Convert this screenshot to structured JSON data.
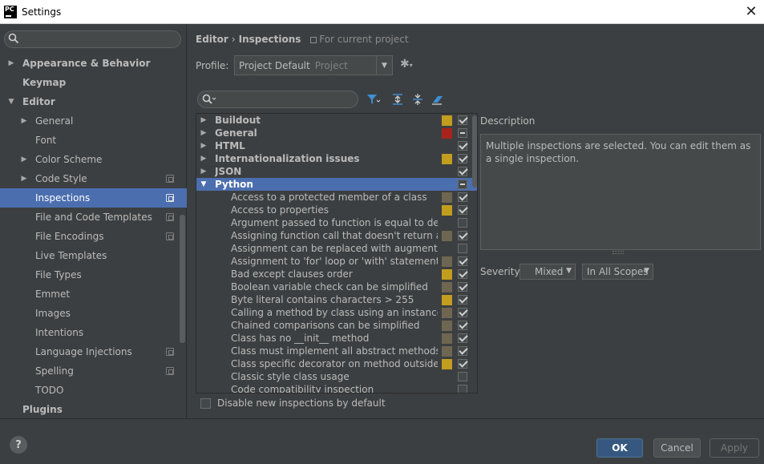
{
  "window": {
    "title": "Settings",
    "app_icon_text": "PC"
  },
  "sidebar": {
    "search_placeholder": "",
    "items": [
      {
        "label": "Appearance & Behavior",
        "bold": true,
        "arrow": "▶",
        "indent": 0
      },
      {
        "label": "Keymap",
        "bold": true,
        "arrow": "",
        "indent": 0
      },
      {
        "label": "Editor",
        "bold": true,
        "arrow": "▼",
        "indent": 0
      },
      {
        "label": "General",
        "bold": false,
        "arrow": "▶",
        "indent": 1
      },
      {
        "label": "Font",
        "bold": false,
        "arrow": "",
        "indent": 1
      },
      {
        "label": "Color Scheme",
        "bold": false,
        "arrow": "▶",
        "indent": 1
      },
      {
        "label": "Code Style",
        "bold": false,
        "arrow": "▶",
        "indent": 1,
        "project": true
      },
      {
        "label": "Inspections",
        "bold": false,
        "arrow": "",
        "indent": 1,
        "project": true,
        "selected": true
      },
      {
        "label": "File and Code Templates",
        "bold": false,
        "arrow": "",
        "indent": 1,
        "project": true
      },
      {
        "label": "File Encodings",
        "bold": false,
        "arrow": "",
        "indent": 1,
        "project": true
      },
      {
        "label": "Live Templates",
        "bold": false,
        "arrow": "",
        "indent": 1
      },
      {
        "label": "File Types",
        "bold": false,
        "arrow": "",
        "indent": 1
      },
      {
        "label": "Emmet",
        "bold": false,
        "arrow": "",
        "indent": 1
      },
      {
        "label": "Images",
        "bold": false,
        "arrow": "",
        "indent": 1
      },
      {
        "label": "Intentions",
        "bold": false,
        "arrow": "",
        "indent": 1
      },
      {
        "label": "Language Injections",
        "bold": false,
        "arrow": "",
        "indent": 1,
        "project": true
      },
      {
        "label": "Spelling",
        "bold": false,
        "arrow": "",
        "indent": 1,
        "project": true
      },
      {
        "label": "TODO",
        "bold": false,
        "arrow": "",
        "indent": 1
      },
      {
        "label": "Plugins",
        "bold": true,
        "arrow": "",
        "indent": 0
      }
    ]
  },
  "header": {
    "crumb_1": "Editor",
    "crumb_sep": "›",
    "crumb_2": "Inspections",
    "scope_note": "For current project"
  },
  "profile": {
    "label": "Profile:",
    "value": "Project Default",
    "value_suffix": "Project"
  },
  "inspections": [
    {
      "name": "Buildout",
      "group": true,
      "arrow": "▶",
      "sev": "#c29d1e",
      "check": "checked"
    },
    {
      "name": "General",
      "group": true,
      "arrow": "▶",
      "sev": "#a8231c",
      "check": "mixed"
    },
    {
      "name": "HTML",
      "group": true,
      "arrow": "▶",
      "sev": "",
      "check": "checked"
    },
    {
      "name": "Internationalization issues",
      "group": true,
      "arrow": "▶",
      "sev": "#c29d1e",
      "check": "checked"
    },
    {
      "name": "JSON",
      "group": true,
      "arrow": "▶",
      "sev": "",
      "check": "checked"
    },
    {
      "name": "Python",
      "group": true,
      "arrow": "▼",
      "sev": "",
      "check": "mixed",
      "selected": true
    },
    {
      "name": "Access to a protected member of a class",
      "sev": "#6e6650",
      "check": "checked"
    },
    {
      "name": "Access to properties",
      "sev": "#c29d1e",
      "check": "checked"
    },
    {
      "name": "Argument passed to function is equal to default p",
      "sev": "",
      "check": "unchecked"
    },
    {
      "name": "Assigning function call that doesn't return anythi",
      "sev": "#6e6650",
      "check": "checked"
    },
    {
      "name": "Assignment can be replaced with augmented ass",
      "sev": "",
      "check": "unchecked"
    },
    {
      "name": "Assignment to 'for' loop or 'with' statement para",
      "sev": "#6e6650",
      "check": "checked"
    },
    {
      "name": "Bad except clauses order",
      "sev": "#c29d1e",
      "check": "checked"
    },
    {
      "name": "Boolean variable check can be simplified",
      "sev": "#6e6650",
      "check": "checked"
    },
    {
      "name": "Byte literal contains characters > 255",
      "sev": "#c29d1e",
      "check": "checked"
    },
    {
      "name": "Calling a method by class using an instance of a c",
      "sev": "#6e6650",
      "check": "checked"
    },
    {
      "name": "Chained comparisons can be simplified",
      "sev": "#6e6650",
      "check": "checked"
    },
    {
      "name": "Class has no __init__ method",
      "sev": "#6e6650",
      "check": "checked"
    },
    {
      "name": "Class must implement all abstract methods",
      "sev": "#6e6650",
      "check": "checked"
    },
    {
      "name": "Class specific decorator on method outside class",
      "sev": "#c29d1e",
      "check": "checked"
    },
    {
      "name": "Classic style class usage",
      "sev": "",
      "check": "unchecked"
    },
    {
      "name": "Code compatibility inspection",
      "sev": "",
      "check": "unchecked"
    }
  ],
  "description": {
    "label": "Description",
    "text": "Multiple inspections are selected. You can edit them as a single inspection."
  },
  "severity": {
    "label": "Severity:",
    "value": "Mixed",
    "scope": "In All Scopes"
  },
  "disable_new": {
    "label": "Disable new inspections by default",
    "checked": false
  },
  "buttons": {
    "ok": "OK",
    "cancel": "Cancel",
    "apply": "Apply",
    "help": "?"
  }
}
